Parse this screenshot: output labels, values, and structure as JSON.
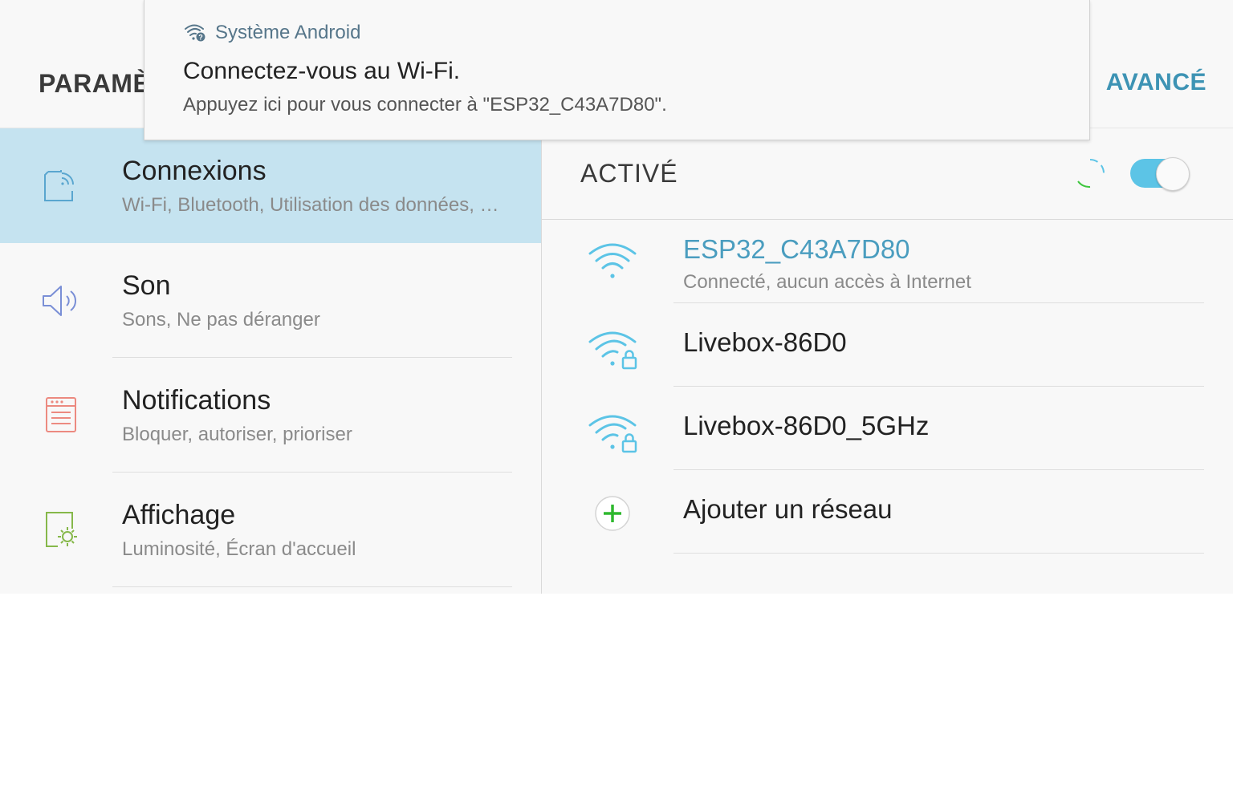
{
  "header": {
    "title": "PARAMÈTRES",
    "action": "AVANCÉ"
  },
  "notification": {
    "icon": "wifi-question-icon",
    "app": "Système Android",
    "title": "Connectez-vous au Wi-Fi.",
    "text": "Appuyez ici pour vous connecter à \"ESP32_C43A7D80\"."
  },
  "sidebar": {
    "items": [
      {
        "icon": "connections-icon",
        "title": "Connexions",
        "subtitle": "Wi-Fi, Bluetooth, Utilisation des données, Mode Hors-ligne",
        "selected": true
      },
      {
        "icon": "speaker-icon",
        "title": "Son",
        "subtitle": "Sons, Ne pas déranger"
      },
      {
        "icon": "notifications-icon",
        "title": "Notifications",
        "subtitle": "Bloquer, autoriser, prioriser"
      },
      {
        "icon": "display-icon",
        "title": "Affichage",
        "subtitle": "Luminosité, Écran d'accueil"
      }
    ]
  },
  "wifi": {
    "master_label": "ACTIVÉ",
    "enabled": true,
    "networks": [
      {
        "icon": "wifi-icon",
        "name": "ESP32_C43A7D80",
        "status": "Connecté, aucun accès à Internet",
        "connected": true
      },
      {
        "icon": "wifi-lock-icon",
        "name": "Livebox-86D0",
        "secured": true
      },
      {
        "icon": "wifi-lock-icon",
        "name": "Livebox-86D0_5GHz",
        "secured": true
      }
    ],
    "add_network": {
      "icon": "plus-icon",
      "label": "Ajouter un réseau"
    }
  },
  "colors": {
    "accent": "#3d93b4",
    "selected_bg": "#c5e3f0",
    "toggle_on": "#5cc4e6",
    "wifi_icon": "#5cc4e6",
    "add_icon": "#2eb82e"
  }
}
